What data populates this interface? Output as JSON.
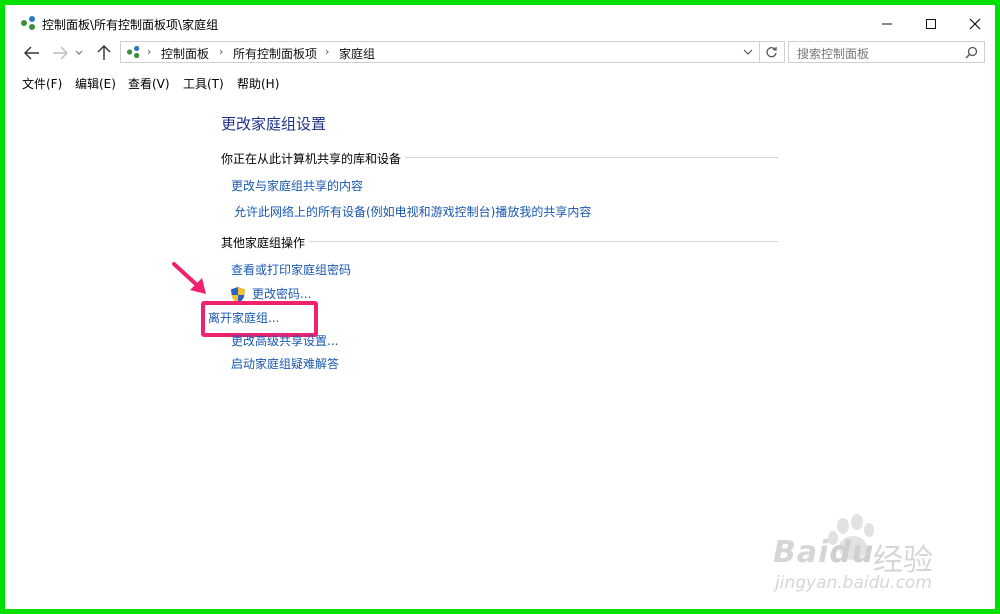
{
  "window": {
    "title": "控制面板\\所有控制面板项\\家庭组",
    "minimize_icon": "minimize-icon",
    "maximize_icon": "maximize-icon",
    "close_icon": "close-icon"
  },
  "address": {
    "breadcrumbs": [
      "控制面板",
      "所有控制面板项",
      "家庭组"
    ],
    "search_placeholder": "搜索控制面板"
  },
  "menu": [
    "文件(F)",
    "编辑(E)",
    "查看(V)",
    "工具(T)",
    "帮助(H)"
  ],
  "main": {
    "title": "更改家庭组设置",
    "section1": {
      "heading": "你正在从此计算机共享的库和设备",
      "links": [
        "更改与家庭组共享的内容",
        "允许此网络上的所有设备(例如电视和游戏控制台)播放我的共享内容"
      ]
    },
    "section2": {
      "heading": "其他家庭组操作",
      "links": [
        "查看或打印家庭组密码",
        "更改密码...",
        "离开家庭组...",
        "更改高级共享设置...",
        "启动家庭组疑难解答"
      ]
    }
  },
  "watermark": {
    "brand": "Bai",
    "brand2": "du",
    "product": "经验",
    "url": "jingyan.baidu.com"
  },
  "colors": {
    "frame": "#00e000",
    "link": "#1a58b0",
    "title": "#1e3287",
    "highlight": "#f0226e"
  }
}
